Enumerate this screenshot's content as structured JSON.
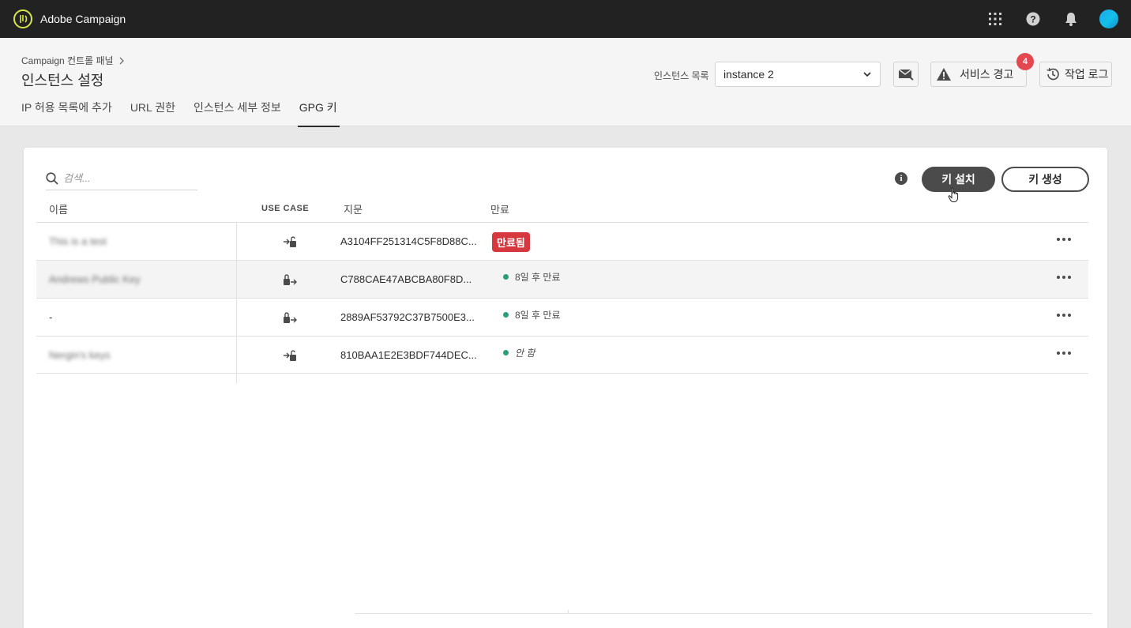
{
  "app": {
    "title": "Adobe Campaign"
  },
  "topbar": {
    "icons": [
      "apps-grid-icon",
      "help-icon",
      "notifications-bell-icon",
      "avatar"
    ]
  },
  "breadcrumb": {
    "parent": "Campaign 컨트롤 패널"
  },
  "page": {
    "title": "인스턴스 설정"
  },
  "tabs": [
    {
      "label": "IP 허용 목록에 추가",
      "active": false
    },
    {
      "label": "URL 권한",
      "active": false
    },
    {
      "label": "인스턴스 세부 정보",
      "active": false
    },
    {
      "label": "GPG 키",
      "active": true
    }
  ],
  "instance_selector": {
    "label": "인스턴스 목록",
    "value": "instance 2"
  },
  "service_alert": {
    "label": "서비스 경고",
    "count": "4"
  },
  "job_log": {
    "label": "작업 로그"
  },
  "search": {
    "placeholder": "검색..."
  },
  "actions": {
    "install_label": "키 설치",
    "generate_label": "키 생성"
  },
  "table": {
    "columns": {
      "name": "이름",
      "use_case": "USE CASE",
      "fingerprint": "지문",
      "expiration": "만료"
    },
    "rows": [
      {
        "name": "This is a test",
        "use_case_icon": "decrypt-icon",
        "fingerprint": "A3104FF251314C5F8D88C...",
        "expiration": "만료됨",
        "status": "expired"
      },
      {
        "name": "Andrews Public Key",
        "use_case_icon": "encrypt-icon",
        "fingerprint": "C788CAE47ABCBA80F8D...",
        "expiration": "8일 후 만료",
        "status": "active"
      },
      {
        "name": "-",
        "use_case_icon": "encrypt-icon",
        "fingerprint": "2889AF53792C37B7500E3...",
        "expiration": "8일 후 만료",
        "status": "active"
      },
      {
        "name": "Nergin's keys",
        "use_case_icon": "decrypt-icon",
        "fingerprint": "810BAA1E2E3BDF744DEC...",
        "expiration": "안 함",
        "status": "never"
      }
    ]
  },
  "colors": {
    "topbar": "#222222",
    "expired": "#d7373f",
    "active_dot": "#2d9d78",
    "badge": "#e34850",
    "logo_accent": "#d6e64a"
  }
}
